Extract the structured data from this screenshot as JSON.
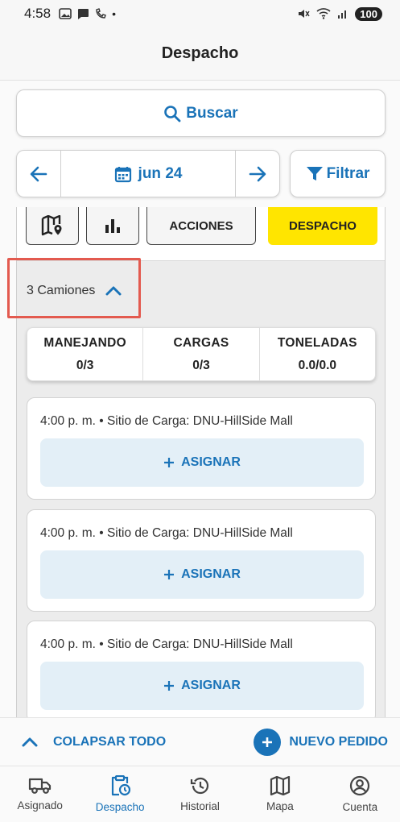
{
  "status_bar": {
    "time": "4:58",
    "battery": "100",
    "dot": "•"
  },
  "header": {
    "title": "Despacho"
  },
  "search": {
    "label": "Buscar"
  },
  "date_nav": {
    "date": "jun 24"
  },
  "filter": {
    "label": "Filtrar"
  },
  "tools": {
    "actions_label": "ACCIONES",
    "dispatch_label": "DESPACHO"
  },
  "trucks": {
    "label": "3 Camiones"
  },
  "stats": [
    {
      "label": "MANEJANDO",
      "value": "0/3"
    },
    {
      "label": "CARGAS",
      "value": "0/3"
    },
    {
      "label": "TONELADAS",
      "value": "0.0/0.0"
    }
  ],
  "orders": [
    {
      "line": "4:00 p. m. • Sitio de Carga: DNU-HillSide Mall",
      "assign": "ASIGNAR"
    },
    {
      "line": "4:00 p. m. • Sitio de Carga: DNU-HillSide Mall",
      "assign": "ASIGNAR"
    },
    {
      "line": "4:00 p. m. • Sitio de Carga: DNU-HillSide Mall",
      "assign": "ASIGNAR"
    }
  ],
  "bottom_actions": {
    "collapse_all": "COLAPSAR TODO",
    "new_order": "NUEVO PEDIDO"
  },
  "tabs": [
    {
      "label": "Asignado",
      "icon": "truck-icon"
    },
    {
      "label": "Despacho",
      "icon": "clipboard-clock-icon"
    },
    {
      "label": "Historial",
      "icon": "history-icon"
    },
    {
      "label": "Mapa",
      "icon": "map-icon"
    },
    {
      "label": "Cuenta",
      "icon": "account-icon"
    }
  ],
  "colors": {
    "accent": "#1a73b8",
    "dispatch_yellow": "#ffe500",
    "highlight": "#e35a4f"
  }
}
